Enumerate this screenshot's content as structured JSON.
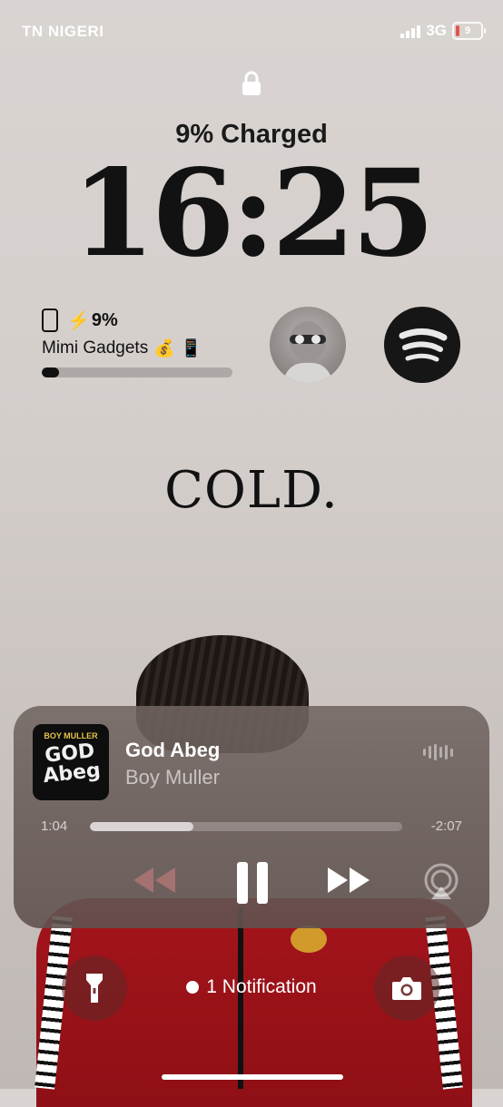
{
  "status_bar": {
    "carrier": "TN NIGERI",
    "network": "3G",
    "battery": "9"
  },
  "lock": {
    "charged_text": "9% Charged",
    "time": "16:25"
  },
  "battery_widget": {
    "percent": "9%",
    "device_name": "Mimi Gadgets",
    "emoji_money": "💰",
    "emoji_device": "📱",
    "level_fraction": 0.09
  },
  "wallpaper_text": "COLD.",
  "now_playing": {
    "title": "God Abeg",
    "artist": "Boy Muller",
    "art_top_text": "BOY MULLER",
    "art_main_text": "GOD Abeg",
    "elapsed": "1:04",
    "remaining": "-2:07",
    "progress_fraction": 0.33
  },
  "bottom": {
    "notification_text": "1 Notification"
  },
  "colors": {
    "jacket": "#a5141b",
    "player_bg": "#6f625f",
    "spotify_widget": "#161616"
  },
  "icons": [
    "lock-icon",
    "signal-icon",
    "battery-icon",
    "phone-icon",
    "bolt-icon",
    "spotify-icon",
    "waveform-icon",
    "rewind-icon",
    "pause-icon",
    "fast-forward-icon",
    "airplay-icon",
    "flashlight-icon",
    "camera-icon"
  ]
}
